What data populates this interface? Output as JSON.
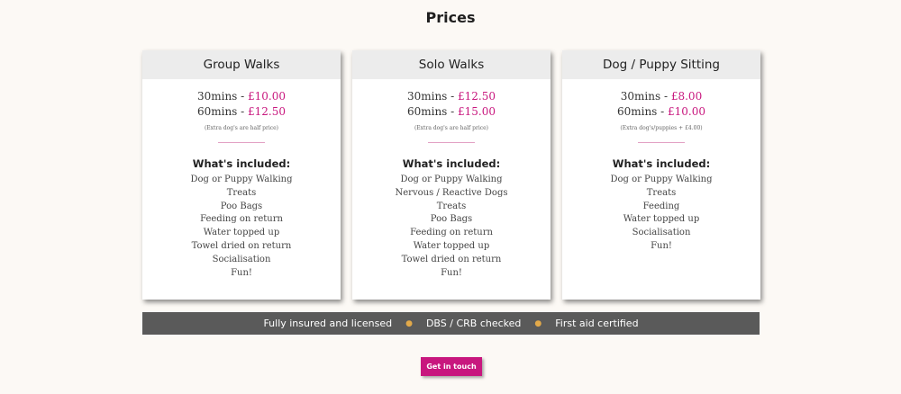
{
  "page": {
    "title": "Prices"
  },
  "cards": [
    {
      "title": "Group Walks",
      "prices": [
        {
          "duration": "30mins - ",
          "amount": "£10.00"
        },
        {
          "duration": "60mins - ",
          "amount": "£12.50"
        }
      ],
      "note": "(Extra dog's are half price)",
      "included_title": "What's included:",
      "included": [
        "Dog or Puppy Walking",
        "Treats",
        "Poo Bags",
        "Feeding on return",
        "Water topped up",
        "Towel dried on return",
        "Socialisation",
        "Fun!"
      ]
    },
    {
      "title": "Solo Walks",
      "prices": [
        {
          "duration": "30mins - ",
          "amount": "£12.50"
        },
        {
          "duration": "60mins - ",
          "amount": "£15.00"
        }
      ],
      "note": "(Extra dog's are half price)",
      "included_title": "What's included:",
      "included": [
        "Dog or Puppy Walking",
        "Nervous / Reactive Dogs",
        "Treats",
        "Poo Bags",
        "Feeding on return",
        "Water topped up",
        "Towel dried on return",
        "Fun!"
      ]
    },
    {
      "title": "Dog / Puppy Sitting",
      "prices": [
        {
          "duration": "30mins - ",
          "amount": "£8.00"
        },
        {
          "duration": "60mins - ",
          "amount": "£10.00"
        }
      ],
      "note": "(Extra dog's/puppies + £4.00)",
      "included_title": "What's included:",
      "included": [
        "Dog or Puppy Walking",
        "Treats",
        "Feeding",
        "Water topped up",
        "Socialisation",
        "Fun!"
      ]
    }
  ],
  "banner": {
    "items": [
      "Fully insured and licensed",
      "DBS / CRB checked",
      "First aid certified"
    ],
    "separator_icon": "paw-icon"
  },
  "cta": {
    "label": "Get in touch"
  },
  "colors": {
    "accent": "#c8177e",
    "background": "#fcf9f5",
    "banner": "#5a5a5a",
    "paw": "#e2a94a"
  }
}
